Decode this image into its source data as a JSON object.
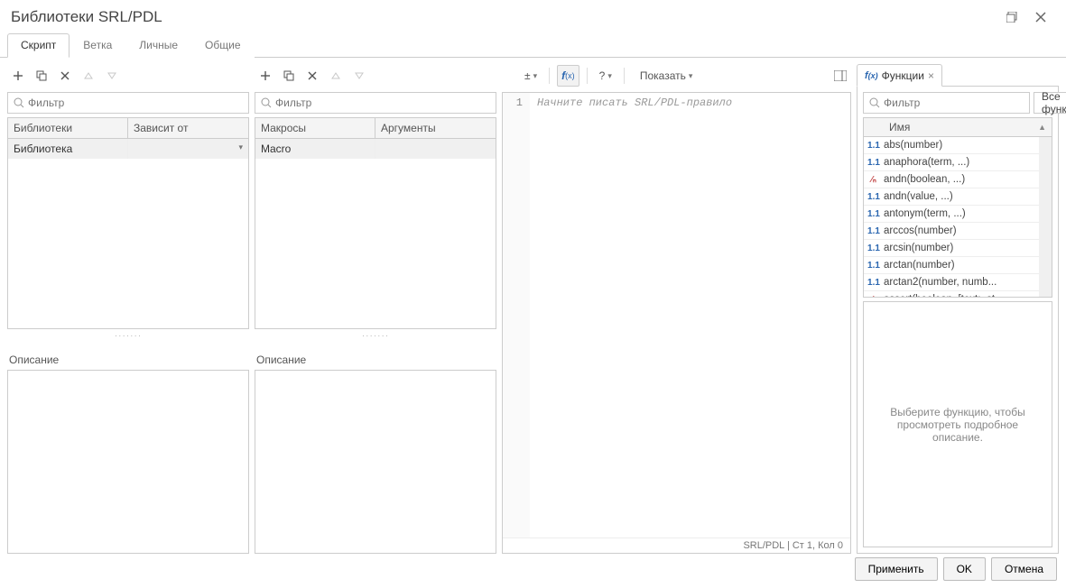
{
  "window": {
    "title": "Библиотеки SRL/PDL"
  },
  "tabs": [
    "Скрипт",
    "Ветка",
    "Личные",
    "Общие"
  ],
  "active_tab_index": 0,
  "filter_placeholder": "Фильтр",
  "left": {
    "headers": [
      "Библиотеки",
      "Зависит от"
    ],
    "row": [
      "Библиотека",
      ""
    ],
    "desc_label": "Описание"
  },
  "mid": {
    "headers": [
      "Макросы",
      "Аргументы"
    ],
    "row": [
      "Macro",
      ""
    ],
    "desc_label": "Описание"
  },
  "editor": {
    "show_label": "Показать",
    "line": "1",
    "placeholder": "Начните писать SRL/PDL-правило",
    "status": "SRL/PDL | Ст 1, Кол 0"
  },
  "right": {
    "tab_label": "Функции",
    "dropdown": "Все функции",
    "name_header": "Имя",
    "desc_placeholder": "Выберите функцию, чтобы просмотреть подробное описание.",
    "functions": [
      {
        "icon": "blue",
        "label": "abs(number)"
      },
      {
        "icon": "blue",
        "label": "anaphora(term, ...)"
      },
      {
        "icon": "red",
        "label": "andn(boolean, ...)"
      },
      {
        "icon": "blue",
        "label": "andn(value, ...)"
      },
      {
        "icon": "blue",
        "label": "antonym(term, ...)"
      },
      {
        "icon": "blue",
        "label": "arccos(number)"
      },
      {
        "icon": "blue",
        "label": "arcsin(number)"
      },
      {
        "icon": "blue",
        "label": "arctan(number)"
      },
      {
        "icon": "blue",
        "label": "arctan2(number, numb..."
      },
      {
        "icon": "red",
        "label": "assert(boolean, [text:=st..."
      }
    ]
  },
  "footer": {
    "apply": "Применить",
    "ok": "OK",
    "cancel": "Отмена"
  }
}
